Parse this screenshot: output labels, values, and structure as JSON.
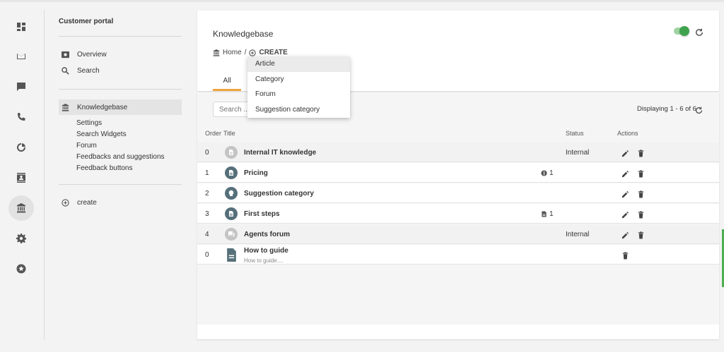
{
  "colors": {
    "accent": "#f0a43e",
    "toggle": "#3fa34d",
    "icon_dark": "#56707a",
    "icon_light": "#c4c4c4"
  },
  "rail": {
    "items": [
      {
        "icon": "dashboard-icon"
      },
      {
        "icon": "mail-icon"
      },
      {
        "icon": "chat-icon"
      },
      {
        "icon": "phone-icon"
      },
      {
        "icon": "report-icon"
      },
      {
        "icon": "contacts-icon"
      },
      {
        "icon": "knowledgebase-icon",
        "active": true
      },
      {
        "icon": "gear-icon"
      },
      {
        "icon": "star-badge-icon"
      }
    ]
  },
  "subnav": {
    "title": "Customer portal",
    "items": [
      {
        "label": "Overview",
        "icon": "overview-icon"
      },
      {
        "label": "Search",
        "icon": "search-icon"
      },
      {
        "label": "Knowledgebase",
        "icon": "knowledgebase-icon",
        "active": true
      }
    ],
    "subitems": [
      "Settings",
      "Search Widgets",
      "Forum",
      "Feedbacks and suggestions",
      "Feedback buttons"
    ],
    "create_label": "create"
  },
  "header": {
    "title": "Knowledgebase",
    "breadcrumb_home": "Home",
    "breadcrumb_sep": "/",
    "breadcrumb_current": "CREATE",
    "tab_all": "All"
  },
  "dropdown": {
    "items": [
      "Article",
      "Category",
      "Forum",
      "Suggestion category"
    ]
  },
  "table": {
    "search_placeholder": "Search ...",
    "displaying": "Displaying 1 - 6 of 6",
    "columns": {
      "order": "Order",
      "title": "Title",
      "status": "Status",
      "actions": "Actions"
    },
    "rows": [
      {
        "order": "0",
        "title": "Internal IT knowledge",
        "icon": "article-icon",
        "status": "Internal",
        "count": "",
        "count_icon": "",
        "subtitle": ""
      },
      {
        "order": "1",
        "title": "Pricing",
        "icon": "article-icon",
        "status": "",
        "count": "1",
        "count_icon": "money-icon",
        "subtitle": ""
      },
      {
        "order": "2",
        "title": "Suggestion category",
        "icon": "bulb-icon",
        "status": "",
        "count": "",
        "count_icon": "",
        "subtitle": ""
      },
      {
        "order": "3",
        "title": "First steps",
        "icon": "article-icon",
        "status": "",
        "count": "1",
        "count_icon": "document-icon",
        "subtitle": ""
      },
      {
        "order": "4",
        "title": "Agents forum",
        "icon": "forum-icon",
        "status": "Internal",
        "count": "",
        "count_icon": "",
        "subtitle": ""
      },
      {
        "order": "0",
        "title": "How to guide",
        "icon": "document-icon",
        "status": "",
        "count": "",
        "count_icon": "",
        "subtitle": "How to guide...."
      }
    ]
  }
}
